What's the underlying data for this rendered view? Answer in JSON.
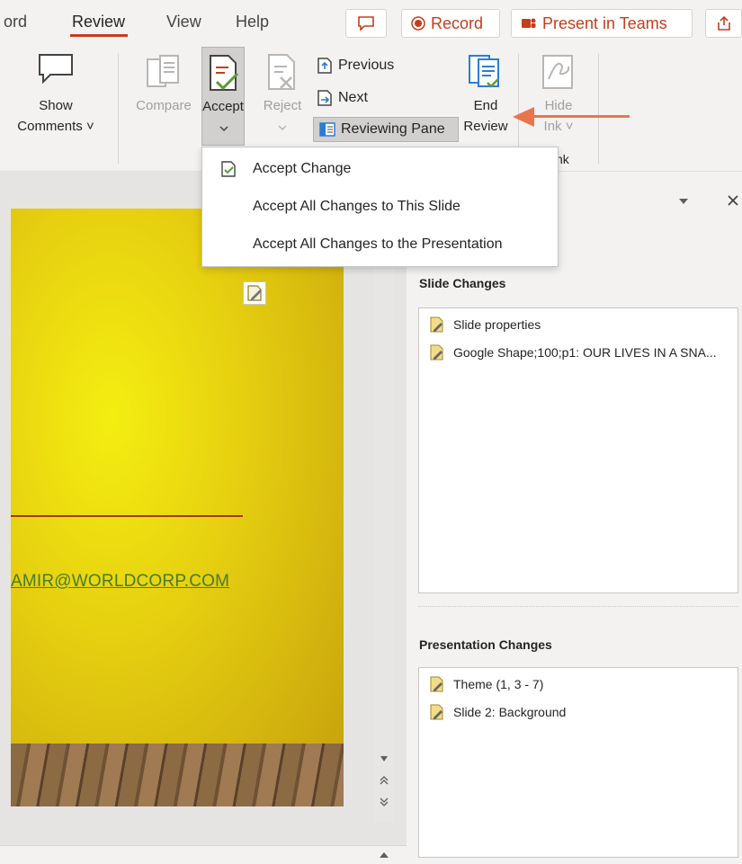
{
  "tabs": [
    {
      "label": "ord"
    },
    {
      "label": "Review"
    },
    {
      "label": "View"
    },
    {
      "label": "Help"
    }
  ],
  "actions": {
    "record": "Record",
    "present_in_teams": "Present in Teams"
  },
  "ribbon": {
    "show_comments": "Show",
    "show_comments_2": "Comments ˅",
    "compare": "Compare",
    "accept": "Accept",
    "reject": "Reject",
    "previous": "Previous",
    "next": "Next",
    "reviewing_pane": "Reviewing Pane",
    "end_review_1": "End",
    "end_review_2": "Review",
    "hide_ink_1": "Hide",
    "hide_ink_2": "Ink ˅",
    "group_ink": "nk"
  },
  "menu": {
    "accept_change": "Accept Change",
    "accept_all_slide": "Accept All Changes to This Slide",
    "accept_all_presentation": "Accept All Changes to the Presentation"
  },
  "slide": {
    "email": "AMIR@WORLDCORP.COM"
  },
  "pane": {
    "slide_changes_heading": "Slide Changes",
    "slide_changes": [
      {
        "label": "Slide properties"
      },
      {
        "label": "Google Shape;100;p1: OUR LIVES IN A SNA..."
      }
    ],
    "presentation_changes_heading": "Presentation Changes",
    "presentation_changes": [
      {
        "label": "Theme (1, 3 - 7)"
      },
      {
        "label": "Slide 2: Background"
      }
    ]
  },
  "colors": {
    "accent": "#c43e1c",
    "arrow": "#e8754c",
    "link": "#4a7b2a"
  }
}
